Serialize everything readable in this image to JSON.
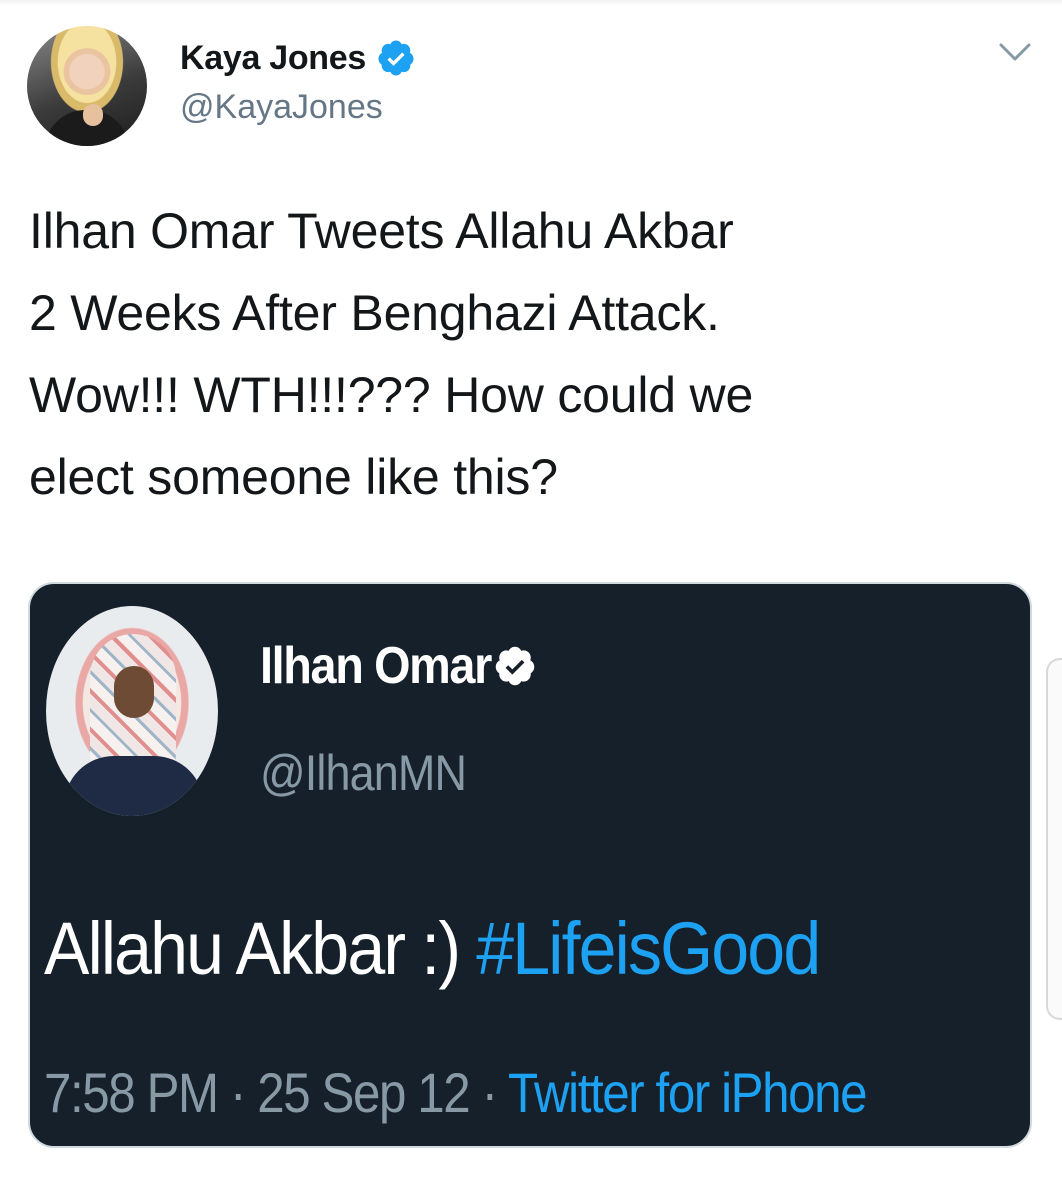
{
  "tweet": {
    "author": {
      "display_name": "Kaya Jones",
      "handle": "@KayaJones",
      "verified": true
    },
    "text_lines": [
      "Ilhan Omar Tweets Allahu Akbar",
      "2 Weeks After Benghazi Attack.",
      "Wow!!! WTH!!!??? How could we",
      "elect someone like this?"
    ],
    "menu_icon": "chevron-down-icon",
    "embedded_screenshot": {
      "author": {
        "display_name": "Ilhan Omar",
        "handle": "@IlhanMN",
        "verified": true
      },
      "text": "Allahu Akbar :)",
      "hashtag": "#LifeisGood",
      "time": "7:58 PM",
      "separator_1": "·",
      "date": "25 Sep 12",
      "separator_2": "·",
      "source": "Twitter for iPhone"
    }
  },
  "colors": {
    "primary_text": "#14171a",
    "secondary_text": "#657786",
    "link_blue": "#1da1f2",
    "verified_blue": "#1da1f2",
    "dark_card_bg": "#16202a"
  }
}
